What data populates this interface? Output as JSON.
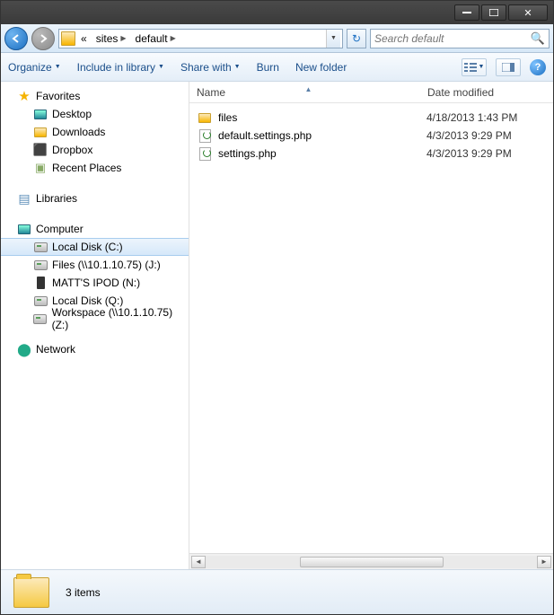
{
  "breadcrumb": {
    "sep0": "«",
    "p1": "sites",
    "p2": "default"
  },
  "search": {
    "placeholder": "Search default"
  },
  "toolbar": {
    "organize": "Organize",
    "include": "Include in library",
    "share": "Share with",
    "burn": "Burn",
    "newfolder": "New folder"
  },
  "sidebar": {
    "favorites": "Favorites",
    "desktop": "Desktop",
    "downloads": "Downloads",
    "dropbox": "Dropbox",
    "recent": "Recent Places",
    "libraries": "Libraries",
    "computer": "Computer",
    "localc": "Local Disk (C:)",
    "filesj": "Files (\\\\10.1.10.75) (J:)",
    "ipod": "MATT'S IPOD (N:)",
    "localq": "Local Disk (Q:)",
    "workspace": "Workspace (\\\\10.1.10.75) (Z:)",
    "network": "Network"
  },
  "columns": {
    "name": "Name",
    "date": "Date modified"
  },
  "files": [
    {
      "name": "files",
      "date": "4/18/2013 1:43 PM",
      "type": "folder"
    },
    {
      "name": "default.settings.php",
      "date": "4/3/2013 9:29 PM",
      "type": "php"
    },
    {
      "name": "settings.php",
      "date": "4/3/2013 9:29 PM",
      "type": "php"
    }
  ],
  "status": {
    "count": "3 items"
  }
}
